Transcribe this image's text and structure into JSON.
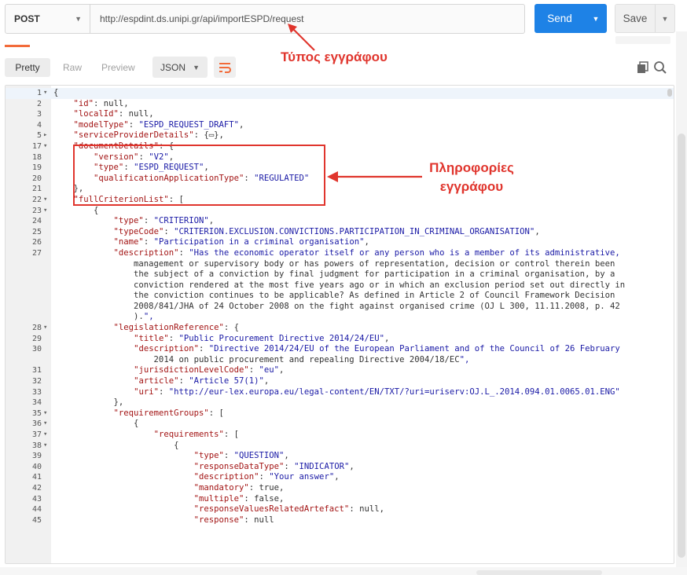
{
  "request": {
    "method": "POST",
    "url": "http://espdint.ds.unipi.gr/api/importESPD/request",
    "send_label": "Send",
    "save_label": "Save"
  },
  "response_toolbar": {
    "pretty": "Pretty",
    "raw": "Raw",
    "preview": "Preview",
    "format": "JSON"
  },
  "annotations": {
    "doc_type": "Τύπος εγγράφου",
    "doc_info_line1": "Πληροφορίες",
    "doc_info_line2": "εγγράφου"
  },
  "colors": {
    "accent": "#1e82e6",
    "annotation": "#e0352d",
    "json_key": "#a31515",
    "json_string": "#1a1aa6"
  },
  "code_lines": [
    {
      "no": "1",
      "fold": "▾",
      "indent": 0,
      "text": "{"
    },
    {
      "no": "2",
      "fold": "",
      "indent": 4,
      "text": "\"id\": null,"
    },
    {
      "no": "3",
      "fold": "",
      "indent": 4,
      "text": "\"localId\": null,"
    },
    {
      "no": "4",
      "fold": "",
      "indent": 4,
      "text": "\"modelType\": \"ESPD_REQUEST_DRAFT\","
    },
    {
      "no": "5",
      "fold": "▸",
      "indent": 4,
      "text": "\"serviceProviderDetails\": {▭},"
    },
    {
      "no": "17",
      "fold": "▾",
      "indent": 4,
      "text": "\"documentDetails\": {"
    },
    {
      "no": "18",
      "fold": "",
      "indent": 8,
      "text": "\"version\": \"V2\","
    },
    {
      "no": "19",
      "fold": "",
      "indent": 8,
      "text": "\"type\": \"ESPD_REQUEST\","
    },
    {
      "no": "20",
      "fold": "",
      "indent": 8,
      "text": "\"qualificationApplicationType\": \"REGULATED\""
    },
    {
      "no": "21",
      "fold": "",
      "indent": 4,
      "text": "},"
    },
    {
      "no": "22",
      "fold": "▾",
      "indent": 4,
      "text": "\"fullCriterionList\": ["
    },
    {
      "no": "23",
      "fold": "▾",
      "indent": 8,
      "text": "{"
    },
    {
      "no": "24",
      "fold": "",
      "indent": 12,
      "text": "\"type\": \"CRITERION\","
    },
    {
      "no": "25",
      "fold": "",
      "indent": 12,
      "text": "\"typeCode\": \"CRITERION.EXCLUSION.CONVICTIONS.PARTICIPATION_IN_CRIMINAL_ORGANISATION\","
    },
    {
      "no": "26",
      "fold": "",
      "indent": 12,
      "text": "\"name\": \"Participation in a criminal organisation\","
    },
    {
      "no": "27",
      "fold": "",
      "indent": 12,
      "text": "\"description\": \"Has the economic operator itself or any person who is a member of its administrative,"
    },
    {
      "no": "",
      "fold": "",
      "indent": 16,
      "text": "management or supervisory body or has powers of representation, decision or control therein been"
    },
    {
      "no": "",
      "fold": "",
      "indent": 16,
      "text": "the subject of a conviction by final judgment for participation in a criminal organisation, by a"
    },
    {
      "no": "",
      "fold": "",
      "indent": 16,
      "text": "conviction rendered at the most five years ago or in which an exclusion period set out directly in"
    },
    {
      "no": "",
      "fold": "",
      "indent": 16,
      "text": "the conviction continues to be applicable? As defined in Article 2 of Council Framework Decision"
    },
    {
      "no": "",
      "fold": "",
      "indent": 16,
      "text": "2008/841/JHA of 24 October 2008 on the fight against organised crime (OJ L 300, 11.11.2008, p. 42"
    },
    {
      "no": "",
      "fold": "",
      "indent": 16,
      "text": ").\","
    },
    {
      "no": "28",
      "fold": "▾",
      "indent": 12,
      "text": "\"legislationReference\": {"
    },
    {
      "no": "29",
      "fold": "",
      "indent": 16,
      "text": "\"title\": \"Public Procurement Directive 2014/24/EU\","
    },
    {
      "no": "30",
      "fold": "",
      "indent": 16,
      "text": "\"description\": \"Directive 2014/24/EU of the European Parliament and of the Council of 26 February"
    },
    {
      "no": "",
      "fold": "",
      "indent": 20,
      "text": "2014 on public procurement and repealing Directive 2004/18/EC\","
    },
    {
      "no": "31",
      "fold": "",
      "indent": 16,
      "text": "\"jurisdictionLevelCode\": \"eu\","
    },
    {
      "no": "32",
      "fold": "",
      "indent": 16,
      "text": "\"article\": \"Article 57(1)\","
    },
    {
      "no": "33",
      "fold": "",
      "indent": 16,
      "text": "\"uri\": \"http://eur-lex.europa.eu/legal-content/EN/TXT/?uri=uriserv:OJ.L_.2014.094.01.0065.01.ENG\""
    },
    {
      "no": "34",
      "fold": "",
      "indent": 12,
      "text": "},"
    },
    {
      "no": "35",
      "fold": "▾",
      "indent": 12,
      "text": "\"requirementGroups\": ["
    },
    {
      "no": "36",
      "fold": "▾",
      "indent": 16,
      "text": "{"
    },
    {
      "no": "37",
      "fold": "▾",
      "indent": 20,
      "text": "\"requirements\": ["
    },
    {
      "no": "38",
      "fold": "▾",
      "indent": 24,
      "text": "{"
    },
    {
      "no": "39",
      "fold": "",
      "indent": 28,
      "text": "\"type\": \"QUESTION\","
    },
    {
      "no": "40",
      "fold": "",
      "indent": 28,
      "text": "\"responseDataType\": \"INDICATOR\","
    },
    {
      "no": "41",
      "fold": "",
      "indent": 28,
      "text": "\"description\": \"Your answer\","
    },
    {
      "no": "42",
      "fold": "",
      "indent": 28,
      "text": "\"mandatory\": true,"
    },
    {
      "no": "43",
      "fold": "",
      "indent": 28,
      "text": "\"multiple\": false,"
    },
    {
      "no": "44",
      "fold": "",
      "indent": 28,
      "text": "\"responseValuesRelatedArtefact\": null,"
    },
    {
      "no": "45",
      "fold": "",
      "indent": 28,
      "text": "\"response\": null"
    }
  ]
}
